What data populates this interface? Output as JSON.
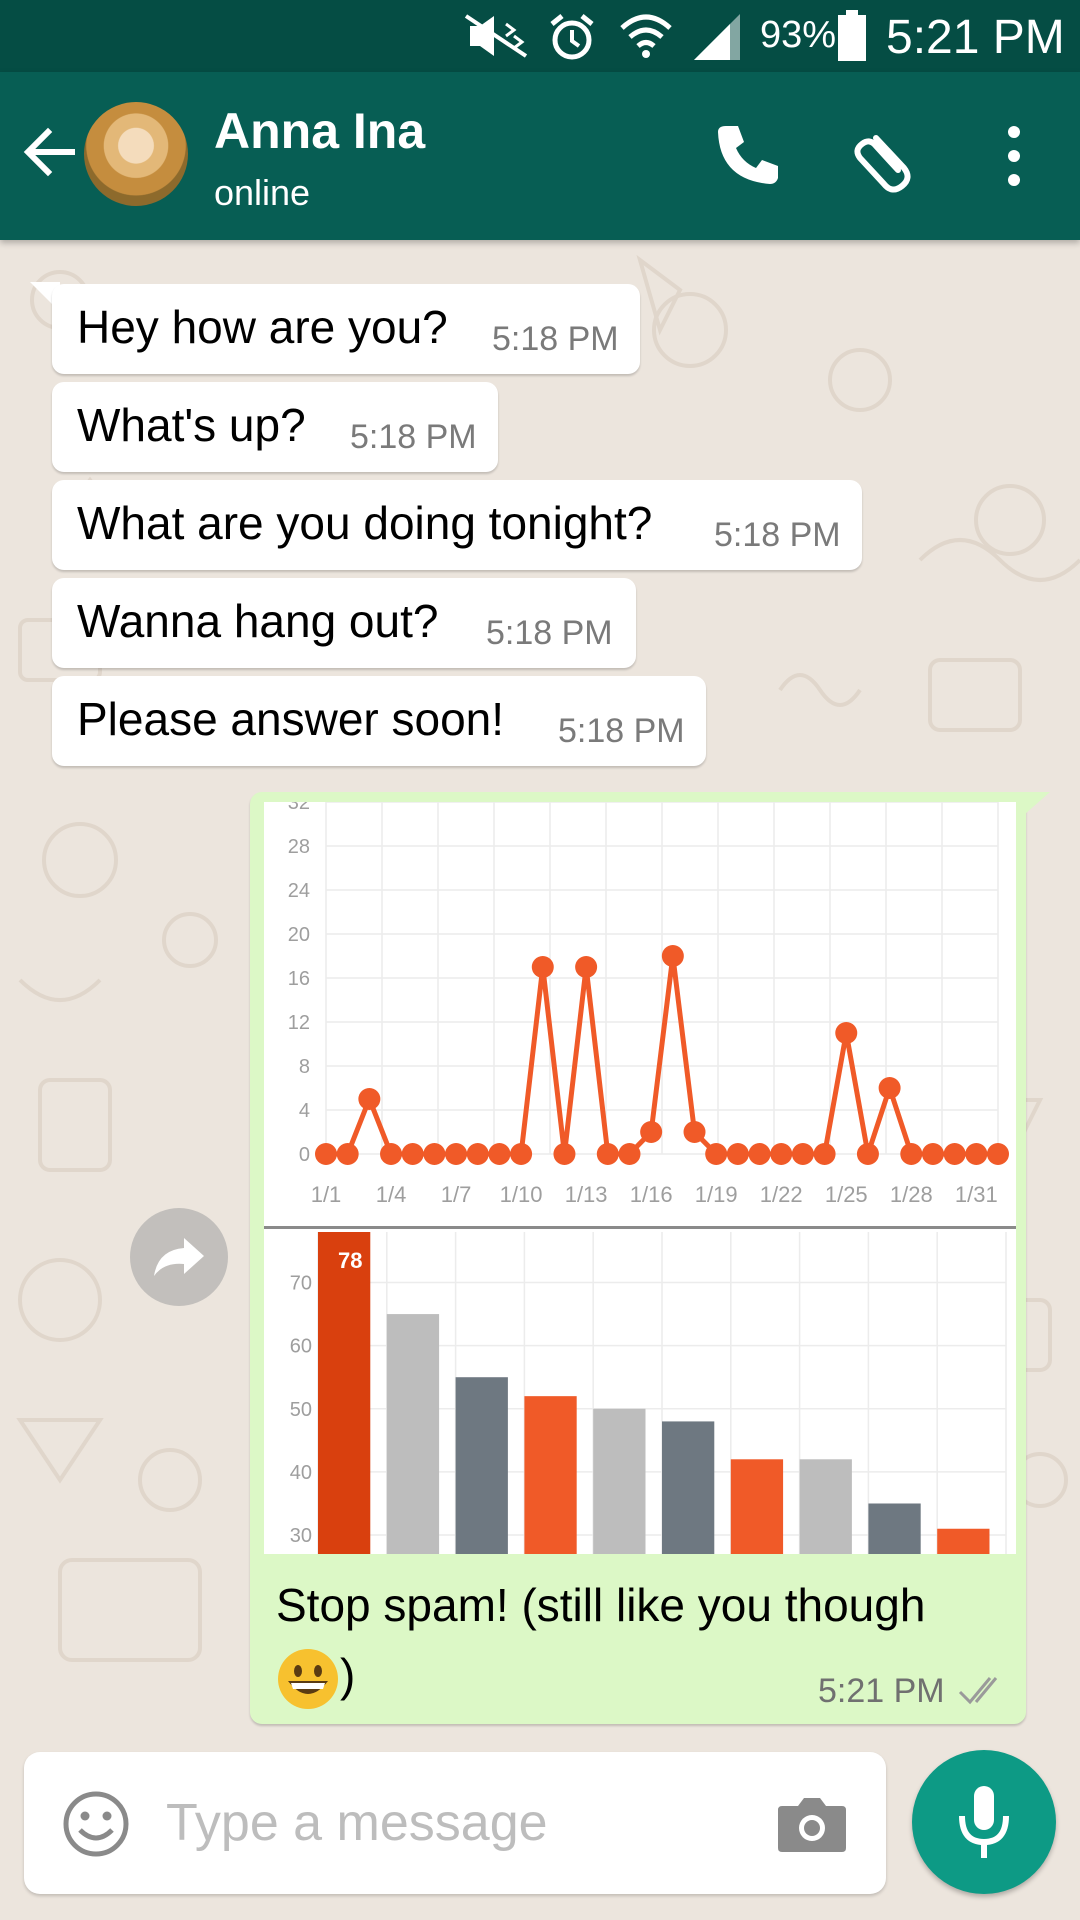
{
  "status_bar": {
    "battery_percent": "93%",
    "time": "5:21 PM",
    "icons": [
      "mute-icon",
      "alarm-icon",
      "wifi-icon",
      "signal-icon",
      "battery-icon"
    ]
  },
  "header": {
    "contact_name": "Anna Ina",
    "status": "online",
    "actions": [
      "back-arrow-icon",
      "phone-icon",
      "paperclip-icon",
      "more-vert-icon"
    ]
  },
  "messages": [
    {
      "text": "Hey how are you?",
      "time": "5:18 PM"
    },
    {
      "text": "What's up?",
      "time": "5:18 PM"
    },
    {
      "text": "What are you doing tonight?",
      "time": "5:18 PM"
    },
    {
      "text": "Wanna hang out?",
      "time": "5:18 PM"
    },
    {
      "text": "Please answer soon!",
      "time": "5:18 PM"
    }
  ],
  "outgoing": {
    "caption": "Stop spam! (still like you though",
    "caption_end": ")",
    "emoji": "grinning-face-icon",
    "time": "5:21 PM",
    "status": "double-check-icon"
  },
  "input": {
    "placeholder": "Type a message"
  },
  "colors": {
    "header": "#075e54",
    "status_bar": "#054d44",
    "outgoing_bubble": "#dcf8c6",
    "accent": "#0d9a85",
    "chart_orange": "#f05a28",
    "chart_dark_orange": "#d9400e",
    "chart_gray": "#bdbdbd",
    "chart_dark_gray": "#6e7881"
  },
  "chart_data": [
    {
      "type": "line",
      "x_ticks": [
        "1/1",
        "1/4",
        "1/7",
        "1/10",
        "1/13",
        "1/16",
        "1/19",
        "1/22",
        "1/25",
        "1/28",
        "1/31"
      ],
      "y_ticks": [
        "0",
        "4",
        "8",
        "12",
        "16",
        "20",
        "24",
        "28",
        "32"
      ],
      "ylim": [
        0,
        32
      ],
      "grid": true,
      "series": [
        {
          "values": [
            0,
            0,
            5,
            0,
            0,
            0,
            0,
            0,
            0,
            0,
            17,
            0,
            17,
            0,
            0,
            2,
            18,
            2,
            0,
            0,
            0,
            0,
            0,
            0,
            11,
            0,
            6,
            0,
            0,
            0,
            0,
            0
          ]
        }
      ]
    },
    {
      "type": "bar",
      "y_ticks": [
        "30",
        "40",
        "50",
        "60",
        "70"
      ],
      "ylim": [
        27,
        78
      ],
      "grid": true,
      "values": [
        78,
        65,
        55,
        52,
        50,
        48,
        42,
        42,
        35,
        31
      ],
      "value_label": "78",
      "bar_colors": [
        "#d9400e",
        "#bdbdbd",
        "#6e7881",
        "#f05a28",
        "#bdbdbd",
        "#6e7881",
        "#f05a28",
        "#bdbdbd",
        "#6e7881",
        "#f05a28"
      ]
    }
  ]
}
